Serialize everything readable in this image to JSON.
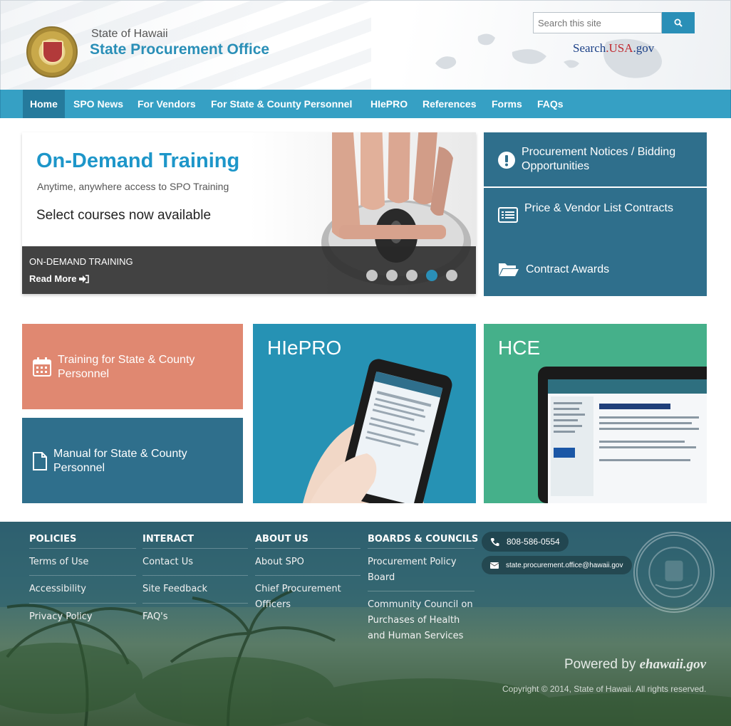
{
  "header": {
    "state_name": "State of Hawaii",
    "office_name": "State Procurement Office",
    "search_placeholder": "Search this site",
    "search_usa_prefix": "Search",
    "search_usa_mid": ".USA",
    "search_usa_suffix": ".gov"
  },
  "nav": {
    "items": [
      {
        "label": "Home"
      },
      {
        "label": "SPO News"
      },
      {
        "label": "For Vendors"
      },
      {
        "label": "For State & County Personnel"
      },
      {
        "label": "HIePRO"
      },
      {
        "label": "References"
      },
      {
        "label": "Forms"
      },
      {
        "label": "FAQs"
      }
    ]
  },
  "hero": {
    "title": "On-Demand Training",
    "subtitle": "Anytime, anywhere access to SPO Training",
    "courses": "Select courses now available",
    "caption_title": "ON-DEMAND TRAINING",
    "read_more": "Read More",
    "slide_count": 5,
    "active_slide": 4
  },
  "panels": [
    {
      "label": "Procurement Notices / Bidding Opportunities",
      "icon": "exclamation-icon"
    },
    {
      "label": "Price & Vendor List Contracts",
      "icon": "list-icon"
    },
    {
      "label": "Contract Awards",
      "icon": "folder-open-icon"
    }
  ],
  "tiles": {
    "training": "Training for State & County Personnel",
    "manual": "Manual for State & County Personnel",
    "hiepro": "HIePRO",
    "hce": "HCE"
  },
  "footer": {
    "policies": {
      "heading": "POLICIES",
      "links": [
        "Terms of Use",
        "Accessibility",
        "Privacy Policy"
      ]
    },
    "interact": {
      "heading": "INTERACT",
      "links": [
        "Contact Us",
        "Site Feedback",
        "FAQ's"
      ]
    },
    "about": {
      "heading": "ABOUT US",
      "links": [
        "About SPO",
        "Chief Procurement Officers"
      ]
    },
    "boards": {
      "heading": "BOARDS & COUNCILS",
      "links": [
        "Procurement Policy Board",
        "Community Council on Purchases of Health and Human Services"
      ]
    },
    "phone": "808-586-0554",
    "email": "state.procurement.office@hawaii.gov",
    "powered_by": "Powered by",
    "powered_brand": "ehawaii.gov",
    "copyright": "Copyright © 2014, State of Hawaii. All rights reserved."
  },
  "colors": {
    "nav": "#36a0c4",
    "accent": "#2a8fb7",
    "panel": "#2f6f8c",
    "training_tile": "#e08871",
    "hiepro_tile": "#2692b4",
    "hce_tile": "#45b08a"
  }
}
